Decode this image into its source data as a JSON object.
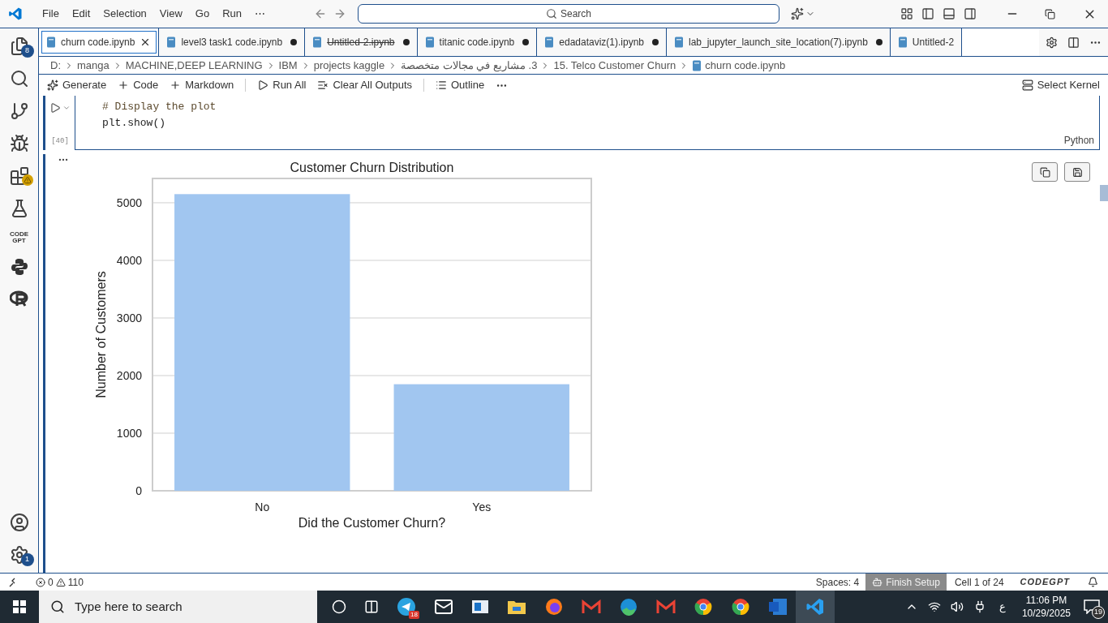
{
  "title_bar": {
    "menus": [
      "File",
      "Edit",
      "Selection",
      "View",
      "Go",
      "Run",
      "⋯"
    ],
    "search": "Search"
  },
  "activity_bar": {
    "explorer_badge": "8",
    "settings_badge": "1",
    "codegpt_logo": [
      "CODE",
      "GPT"
    ]
  },
  "tabs": [
    {
      "label": "churn code.ipynb",
      "selected": true,
      "dirty": false,
      "deleted": false
    },
    {
      "label": "level3 task1 code.ipynb",
      "selected": false,
      "dirty": true,
      "deleted": false
    },
    {
      "label": "Untitled-2.ipynb",
      "selected": false,
      "dirty": true,
      "deleted": true
    },
    {
      "label": "titanic code.ipynb",
      "selected": false,
      "dirty": true,
      "deleted": false
    },
    {
      "label": "edadataviz(1).ipynb",
      "selected": false,
      "dirty": true,
      "deleted": false
    },
    {
      "label": "lab_jupyter_launch_site_location(7).ipynb",
      "selected": false,
      "dirty": true,
      "deleted": false
    },
    {
      "label": "Untitled-2",
      "selected": false,
      "dirty": false,
      "deleted": false
    }
  ],
  "breadcrumbs": [
    "D:",
    "manga",
    "MACHINE,DEEP LEARNING",
    "IBM",
    "projects kaggle",
    "3. مشاريع في مجالات متخصصة",
    "15. Telco Customer Churn",
    "churn code.ipynb"
  ],
  "toolbar": {
    "items": [
      {
        "kind": "generate",
        "label": "Generate"
      },
      {
        "kind": "add",
        "label": "Code"
      },
      {
        "kind": "add",
        "label": "Markdown"
      },
      {
        "kind": "run",
        "label": "Run All"
      },
      {
        "kind": "clear",
        "label": "Clear All Outputs"
      },
      {
        "kind": "outline",
        "label": "Outline"
      }
    ],
    "kernel": "Select Kernel"
  },
  "cell": {
    "lines": [
      {
        "kind": "comment",
        "text": "# Display the plot"
      },
      {
        "kind": "code",
        "text": "plt.show()"
      }
    ],
    "execution_count": "[40]",
    "language": "Python"
  },
  "output": {
    "chart_data": {
      "type": "bar",
      "title": "Customer Churn Distribution",
      "xlabel": "Did the Customer Churn?",
      "ylabel": "Number of Customers",
      "categories": [
        "No",
        "Yes"
      ],
      "series": [
        {
          "color": "#a1c6f0",
          "values": [
            5150,
            1850
          ]
        }
      ],
      "ylim": [
        0,
        5422
      ],
      "grid": true,
      "yticks": [
        0,
        1000,
        2000,
        3000,
        4000,
        5000
      ]
    }
  },
  "status_bar": {
    "errors": "0",
    "warnings": "110",
    "spaces": "Spaces: 4",
    "finish_setup": "Finish Setup",
    "cell": "Cell 1 of 24",
    "brand": "CODEGPT"
  },
  "taskbar": {
    "search_placeholder": "Type here to search",
    "telegram_badge": "18",
    "language": "ع",
    "time": "11:06 PM",
    "date": "10/29/2025",
    "notifications": "19"
  }
}
